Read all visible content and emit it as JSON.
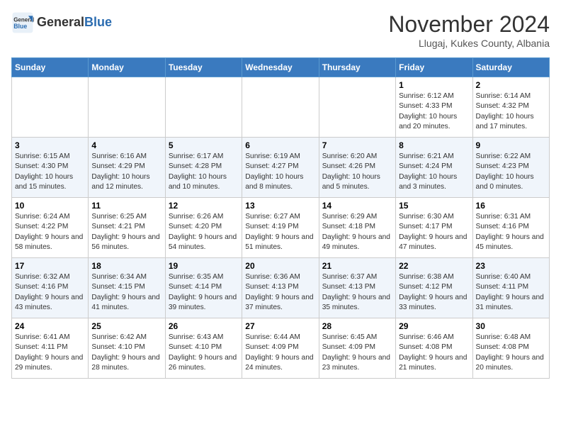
{
  "header": {
    "logo_general": "General",
    "logo_blue": "Blue",
    "month_title": "November 2024",
    "location": "Llugaj, Kukes County, Albania"
  },
  "days_of_week": [
    "Sunday",
    "Monday",
    "Tuesday",
    "Wednesday",
    "Thursday",
    "Friday",
    "Saturday"
  ],
  "weeks": [
    [
      {
        "day": "",
        "info": ""
      },
      {
        "day": "",
        "info": ""
      },
      {
        "day": "",
        "info": ""
      },
      {
        "day": "",
        "info": ""
      },
      {
        "day": "",
        "info": ""
      },
      {
        "day": "1",
        "info": "Sunrise: 6:12 AM\nSunset: 4:33 PM\nDaylight: 10 hours and 20 minutes."
      },
      {
        "day": "2",
        "info": "Sunrise: 6:14 AM\nSunset: 4:32 PM\nDaylight: 10 hours and 17 minutes."
      }
    ],
    [
      {
        "day": "3",
        "info": "Sunrise: 6:15 AM\nSunset: 4:30 PM\nDaylight: 10 hours and 15 minutes."
      },
      {
        "day": "4",
        "info": "Sunrise: 6:16 AM\nSunset: 4:29 PM\nDaylight: 10 hours and 12 minutes."
      },
      {
        "day": "5",
        "info": "Sunrise: 6:17 AM\nSunset: 4:28 PM\nDaylight: 10 hours and 10 minutes."
      },
      {
        "day": "6",
        "info": "Sunrise: 6:19 AM\nSunset: 4:27 PM\nDaylight: 10 hours and 8 minutes."
      },
      {
        "day": "7",
        "info": "Sunrise: 6:20 AM\nSunset: 4:26 PM\nDaylight: 10 hours and 5 minutes."
      },
      {
        "day": "8",
        "info": "Sunrise: 6:21 AM\nSunset: 4:24 PM\nDaylight: 10 hours and 3 minutes."
      },
      {
        "day": "9",
        "info": "Sunrise: 6:22 AM\nSunset: 4:23 PM\nDaylight: 10 hours and 0 minutes."
      }
    ],
    [
      {
        "day": "10",
        "info": "Sunrise: 6:24 AM\nSunset: 4:22 PM\nDaylight: 9 hours and 58 minutes."
      },
      {
        "day": "11",
        "info": "Sunrise: 6:25 AM\nSunset: 4:21 PM\nDaylight: 9 hours and 56 minutes."
      },
      {
        "day": "12",
        "info": "Sunrise: 6:26 AM\nSunset: 4:20 PM\nDaylight: 9 hours and 54 minutes."
      },
      {
        "day": "13",
        "info": "Sunrise: 6:27 AM\nSunset: 4:19 PM\nDaylight: 9 hours and 51 minutes."
      },
      {
        "day": "14",
        "info": "Sunrise: 6:29 AM\nSunset: 4:18 PM\nDaylight: 9 hours and 49 minutes."
      },
      {
        "day": "15",
        "info": "Sunrise: 6:30 AM\nSunset: 4:17 PM\nDaylight: 9 hours and 47 minutes."
      },
      {
        "day": "16",
        "info": "Sunrise: 6:31 AM\nSunset: 4:16 PM\nDaylight: 9 hours and 45 minutes."
      }
    ],
    [
      {
        "day": "17",
        "info": "Sunrise: 6:32 AM\nSunset: 4:16 PM\nDaylight: 9 hours and 43 minutes."
      },
      {
        "day": "18",
        "info": "Sunrise: 6:34 AM\nSunset: 4:15 PM\nDaylight: 9 hours and 41 minutes."
      },
      {
        "day": "19",
        "info": "Sunrise: 6:35 AM\nSunset: 4:14 PM\nDaylight: 9 hours and 39 minutes."
      },
      {
        "day": "20",
        "info": "Sunrise: 6:36 AM\nSunset: 4:13 PM\nDaylight: 9 hours and 37 minutes."
      },
      {
        "day": "21",
        "info": "Sunrise: 6:37 AM\nSunset: 4:13 PM\nDaylight: 9 hours and 35 minutes."
      },
      {
        "day": "22",
        "info": "Sunrise: 6:38 AM\nSunset: 4:12 PM\nDaylight: 9 hours and 33 minutes."
      },
      {
        "day": "23",
        "info": "Sunrise: 6:40 AM\nSunset: 4:11 PM\nDaylight: 9 hours and 31 minutes."
      }
    ],
    [
      {
        "day": "24",
        "info": "Sunrise: 6:41 AM\nSunset: 4:11 PM\nDaylight: 9 hours and 29 minutes."
      },
      {
        "day": "25",
        "info": "Sunrise: 6:42 AM\nSunset: 4:10 PM\nDaylight: 9 hours and 28 minutes."
      },
      {
        "day": "26",
        "info": "Sunrise: 6:43 AM\nSunset: 4:10 PM\nDaylight: 9 hours and 26 minutes."
      },
      {
        "day": "27",
        "info": "Sunrise: 6:44 AM\nSunset: 4:09 PM\nDaylight: 9 hours and 24 minutes."
      },
      {
        "day": "28",
        "info": "Sunrise: 6:45 AM\nSunset: 4:09 PM\nDaylight: 9 hours and 23 minutes."
      },
      {
        "day": "29",
        "info": "Sunrise: 6:46 AM\nSunset: 4:08 PM\nDaylight: 9 hours and 21 minutes."
      },
      {
        "day": "30",
        "info": "Sunrise: 6:48 AM\nSunset: 4:08 PM\nDaylight: 9 hours and 20 minutes."
      }
    ]
  ]
}
